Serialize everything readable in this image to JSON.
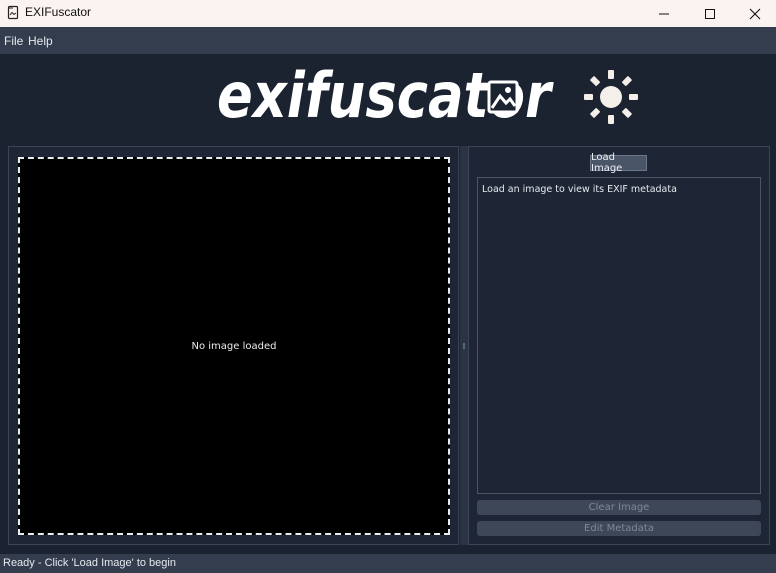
{
  "window": {
    "title": "EXIFuscator",
    "controls": [
      "minimize",
      "maximize",
      "close"
    ]
  },
  "menu": {
    "items": [
      {
        "label": "File"
      },
      {
        "label": "Help"
      }
    ]
  },
  "logo": {
    "text": "exifuscator",
    "icons": [
      "image-icon",
      "theme-toggle-sun-icon"
    ]
  },
  "image_panel": {
    "placeholder": "No image loaded"
  },
  "metadata_panel": {
    "load_button": "Load Image",
    "metadata_text": "Load an image to view its EXIF metadata",
    "clear_button": "Clear Image",
    "edit_button": "Edit Metadata"
  },
  "status_bar": {
    "text": "Ready - Click 'Load Image' to begin"
  },
  "colors": {
    "background": "#1b2230",
    "panel": "#1e2635",
    "bar": "#333d4e",
    "accent_text": "#ffffff",
    "sun": "#f4efe9"
  }
}
